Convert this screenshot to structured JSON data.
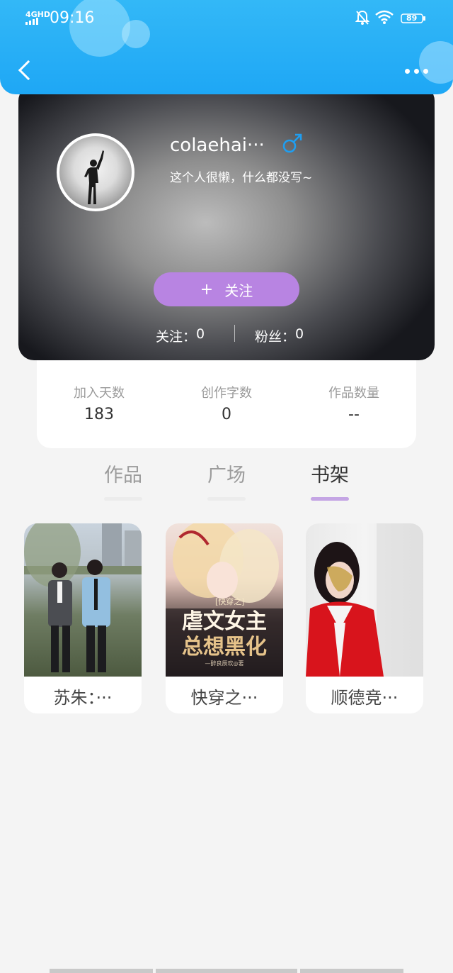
{
  "status_bar": {
    "network": "4GHD",
    "time": "09:16",
    "battery": "89"
  },
  "profile": {
    "username": "colaehai···",
    "gender_symbol": "♂",
    "bio": "这个人很懒，什么都没写~",
    "follow_button_plus": "+",
    "follow_button_label": "关注",
    "following_label": "关注：",
    "following_count": "0",
    "fans_label": "粉丝：",
    "fans_count": "0"
  },
  "stats": [
    {
      "label": "加入天数",
      "value": "183"
    },
    {
      "label": "创作字数",
      "value": "0"
    },
    {
      "label": "作品数量",
      "value": "--"
    }
  ],
  "tabs": [
    {
      "label": "作品",
      "active": false
    },
    {
      "label": "广场",
      "active": false
    },
    {
      "label": "书架",
      "active": true
    }
  ],
  "bookshelf": [
    {
      "title": "苏朱：···"
    },
    {
      "title": "快穿之···",
      "cover_tag": "[快穿之]",
      "cover_line1": "虐文女主",
      "cover_line2": "总想黑化",
      "cover_author": "—醉良辰欢◎著"
    },
    {
      "title": "顺德竞···"
    }
  ],
  "colors": {
    "header": "#1ea7f5",
    "follow_button": "#b884e2",
    "tab_active_underline": "#c4a5e4"
  }
}
